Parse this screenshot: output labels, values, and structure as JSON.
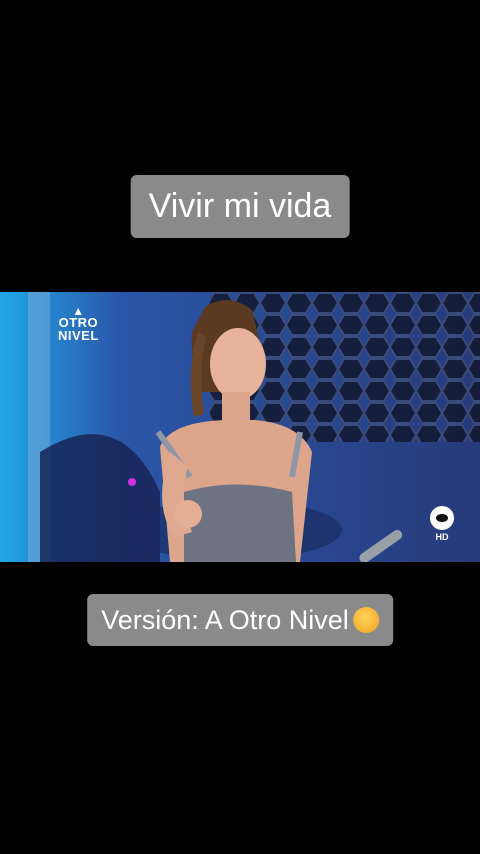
{
  "captions": {
    "top": "Vivir mi vida",
    "bottom": "Versión: A Otro Nivel"
  },
  "video": {
    "logo_line1": "OTRO",
    "logo_line2": "NIVEL",
    "hd_label": "HD",
    "emoji_icon": "exploding-head-emoji"
  }
}
